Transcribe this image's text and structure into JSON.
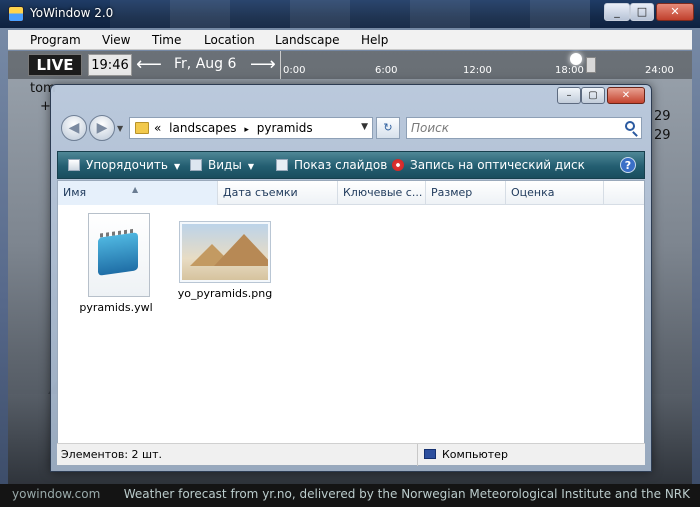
{
  "yowindow": {
    "title": "YoWindow 2.0",
    "window_buttons": {
      "minimize": "_",
      "maximize": "□",
      "close": "✕"
    },
    "menu": [
      "Program",
      "View",
      "Time",
      "Location",
      "Landscape",
      "Help"
    ],
    "timebar": {
      "live": "LIVE",
      "time": "19:46",
      "prev_arrow": "⟵",
      "date": "Fr, Aug 6",
      "next_arrow": "⟶",
      "ticks": [
        "0:00",
        "6:00",
        "12:00",
        "18:00",
        "24:00"
      ]
    },
    "side_texts": {
      "left_top": "tom",
      "left_plus": "+",
      "right_1": "29",
      "right_2": "29"
    },
    "footer": {
      "site": "yowindow.com",
      "credit": "Weather forecast from yr.no, delivered by the Norwegian Meteorological Institute and the NRK"
    }
  },
  "explorer": {
    "caption_buttons": {
      "minimize": "–",
      "maximize": "▢",
      "close": "✕"
    },
    "nav": {
      "back": "◀",
      "forward": "▶",
      "dropdown": "▼"
    },
    "address": {
      "prefix": "«",
      "path": [
        "landscapes",
        "pyramids"
      ],
      "separator": "▸",
      "dropdown": "▼"
    },
    "refresh": "↻",
    "search": {
      "placeholder": "Поиск"
    },
    "commands": [
      {
        "label": "Упорядочить",
        "has_arrow": true
      },
      {
        "label": "Виды",
        "has_arrow": true
      },
      {
        "label": "Показ слайдов",
        "has_arrow": false
      },
      {
        "label": "Запись на оптический диск",
        "has_arrow": false
      }
    ],
    "help": "?",
    "columns": [
      "Имя",
      "Дата съемки",
      "Ключевые с...",
      "Размер",
      "Оценка"
    ],
    "sort_indicator": "▲",
    "files": [
      {
        "name": "pyramids.ywl",
        "icon": "notepad-icon"
      },
      {
        "name": "yo_pyramids.png",
        "icon": "image-icon"
      }
    ],
    "status": {
      "items": "Элементов: 2 шт.",
      "location": "Компьютер"
    }
  },
  "colors": {
    "cmdbar": "#235e71",
    "accent": "#1e395b",
    "yo_title": "#142a4a"
  }
}
